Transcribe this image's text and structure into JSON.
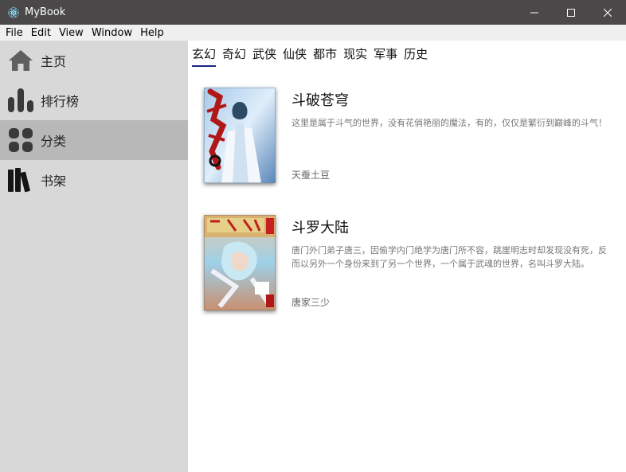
{
  "window": {
    "title": "MyBook",
    "app_icon": "electron-atom-icon"
  },
  "menu": [
    "File",
    "Edit",
    "View",
    "Window",
    "Help"
  ],
  "sidebar": {
    "items": [
      {
        "label": "主页",
        "icon": "home-icon"
      },
      {
        "label": "排行榜",
        "icon": "ranking-bars-icon"
      },
      {
        "label": "分类",
        "icon": "category-grid-icon",
        "active": true
      },
      {
        "label": "书架",
        "icon": "bookshelf-icon"
      }
    ]
  },
  "tabs": [
    {
      "label": "玄幻",
      "active": true
    },
    {
      "label": "奇幻"
    },
    {
      "label": "武侠"
    },
    {
      "label": "仙侠"
    },
    {
      "label": "都市"
    },
    {
      "label": "现实"
    },
    {
      "label": "军事"
    },
    {
      "label": "历史"
    }
  ],
  "books": [
    {
      "title": "斗破苍穹",
      "description": "这里是属于斗气的世界，没有花俏艳丽的魔法，有的，仅仅是繁衍到巅峰的斗气！",
      "author": "天蚕土豆"
    },
    {
      "title": "斗罗大陆",
      "description": "唐门外门弟子唐三，因偷学内门绝学为唐门所不容，跳崖明志时却发现没有死，反而以另外一个身份来到了另一个世界，一个属于武魂的世界，名叫斗罗大陆。",
      "author": "唐家三少"
    }
  ],
  "colors": {
    "titlebar": "#4a4848",
    "menubar": "#f0f0f0",
    "sidebar": "#d8d8d8",
    "sidebar_active": "#b8b8b8",
    "tab_underline": "#1a237e"
  }
}
